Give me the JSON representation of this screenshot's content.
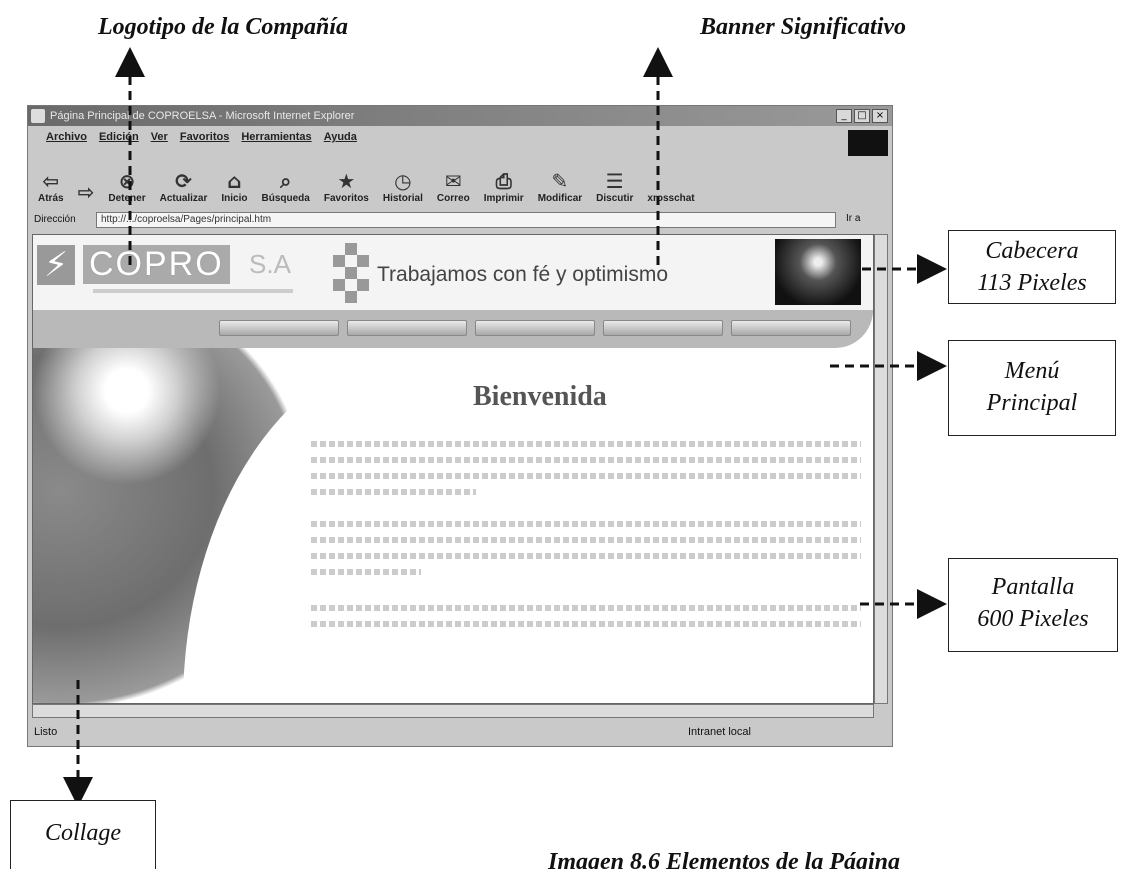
{
  "annotations": {
    "logo_label": "Logotipo de la Compañía",
    "banner_label": "Banner Significativo",
    "header_box": {
      "line1": "Cabecera",
      "line2": "113 Pixeles"
    },
    "menu_box": {
      "line1": "Menú",
      "line2": "Principal"
    },
    "screen_box": {
      "line1": "Pantalla",
      "line2": "600 Pixeles"
    },
    "collage_box": "Collage",
    "caption": "Imagen 8.6  Elementos de la Página"
  },
  "browser": {
    "title": "Página Principal de COPROELSA - Microsoft Internet Explorer",
    "window_buttons": [
      "_",
      "□",
      "×"
    ],
    "menu": [
      "Archivo",
      "Edición",
      "Ver",
      "Favoritos",
      "Herramientas",
      "Ayuda"
    ],
    "toolbar": [
      {
        "label": "Atrás",
        "icon": "back-arrow-icon",
        "glyph": "⇦"
      },
      {
        "label": "",
        "icon": "forward-arrow-icon",
        "glyph": "⇨"
      },
      {
        "label": "Detener",
        "icon": "stop-icon",
        "glyph": "⊗"
      },
      {
        "label": "Actualizar",
        "icon": "refresh-icon",
        "glyph": "⟳"
      },
      {
        "label": "Inicio",
        "icon": "home-icon",
        "glyph": "⌂"
      },
      {
        "label": "Búsqueda",
        "icon": "search-icon",
        "glyph": "⌕"
      },
      {
        "label": "Favoritos",
        "icon": "favorites-icon",
        "glyph": "★"
      },
      {
        "label": "Historial",
        "icon": "history-icon",
        "glyph": "◷"
      },
      {
        "label": "Correo",
        "icon": "mail-icon",
        "glyph": "✉"
      },
      {
        "label": "Imprimir",
        "icon": "print-icon",
        "glyph": "⎙"
      },
      {
        "label": "Modificar",
        "icon": "edit-icon",
        "glyph": "✎"
      },
      {
        "label": "Discutir",
        "icon": "discuss-icon",
        "glyph": "☰"
      },
      {
        "label": "xrosschat",
        "icon": "chat-icon",
        "glyph": ""
      }
    ],
    "address_label": "Dirección",
    "address_value": "http://.../coproelsa/Pages/principal.htm",
    "go_label": "Ir a",
    "status_left": "Listo",
    "status_right": "Intranet local"
  },
  "page": {
    "logo_text": "COPRO",
    "logo_suffix": "S.A",
    "slogan": "Trabajamos con fé y optimismo",
    "welcome": "Bienvenida"
  }
}
